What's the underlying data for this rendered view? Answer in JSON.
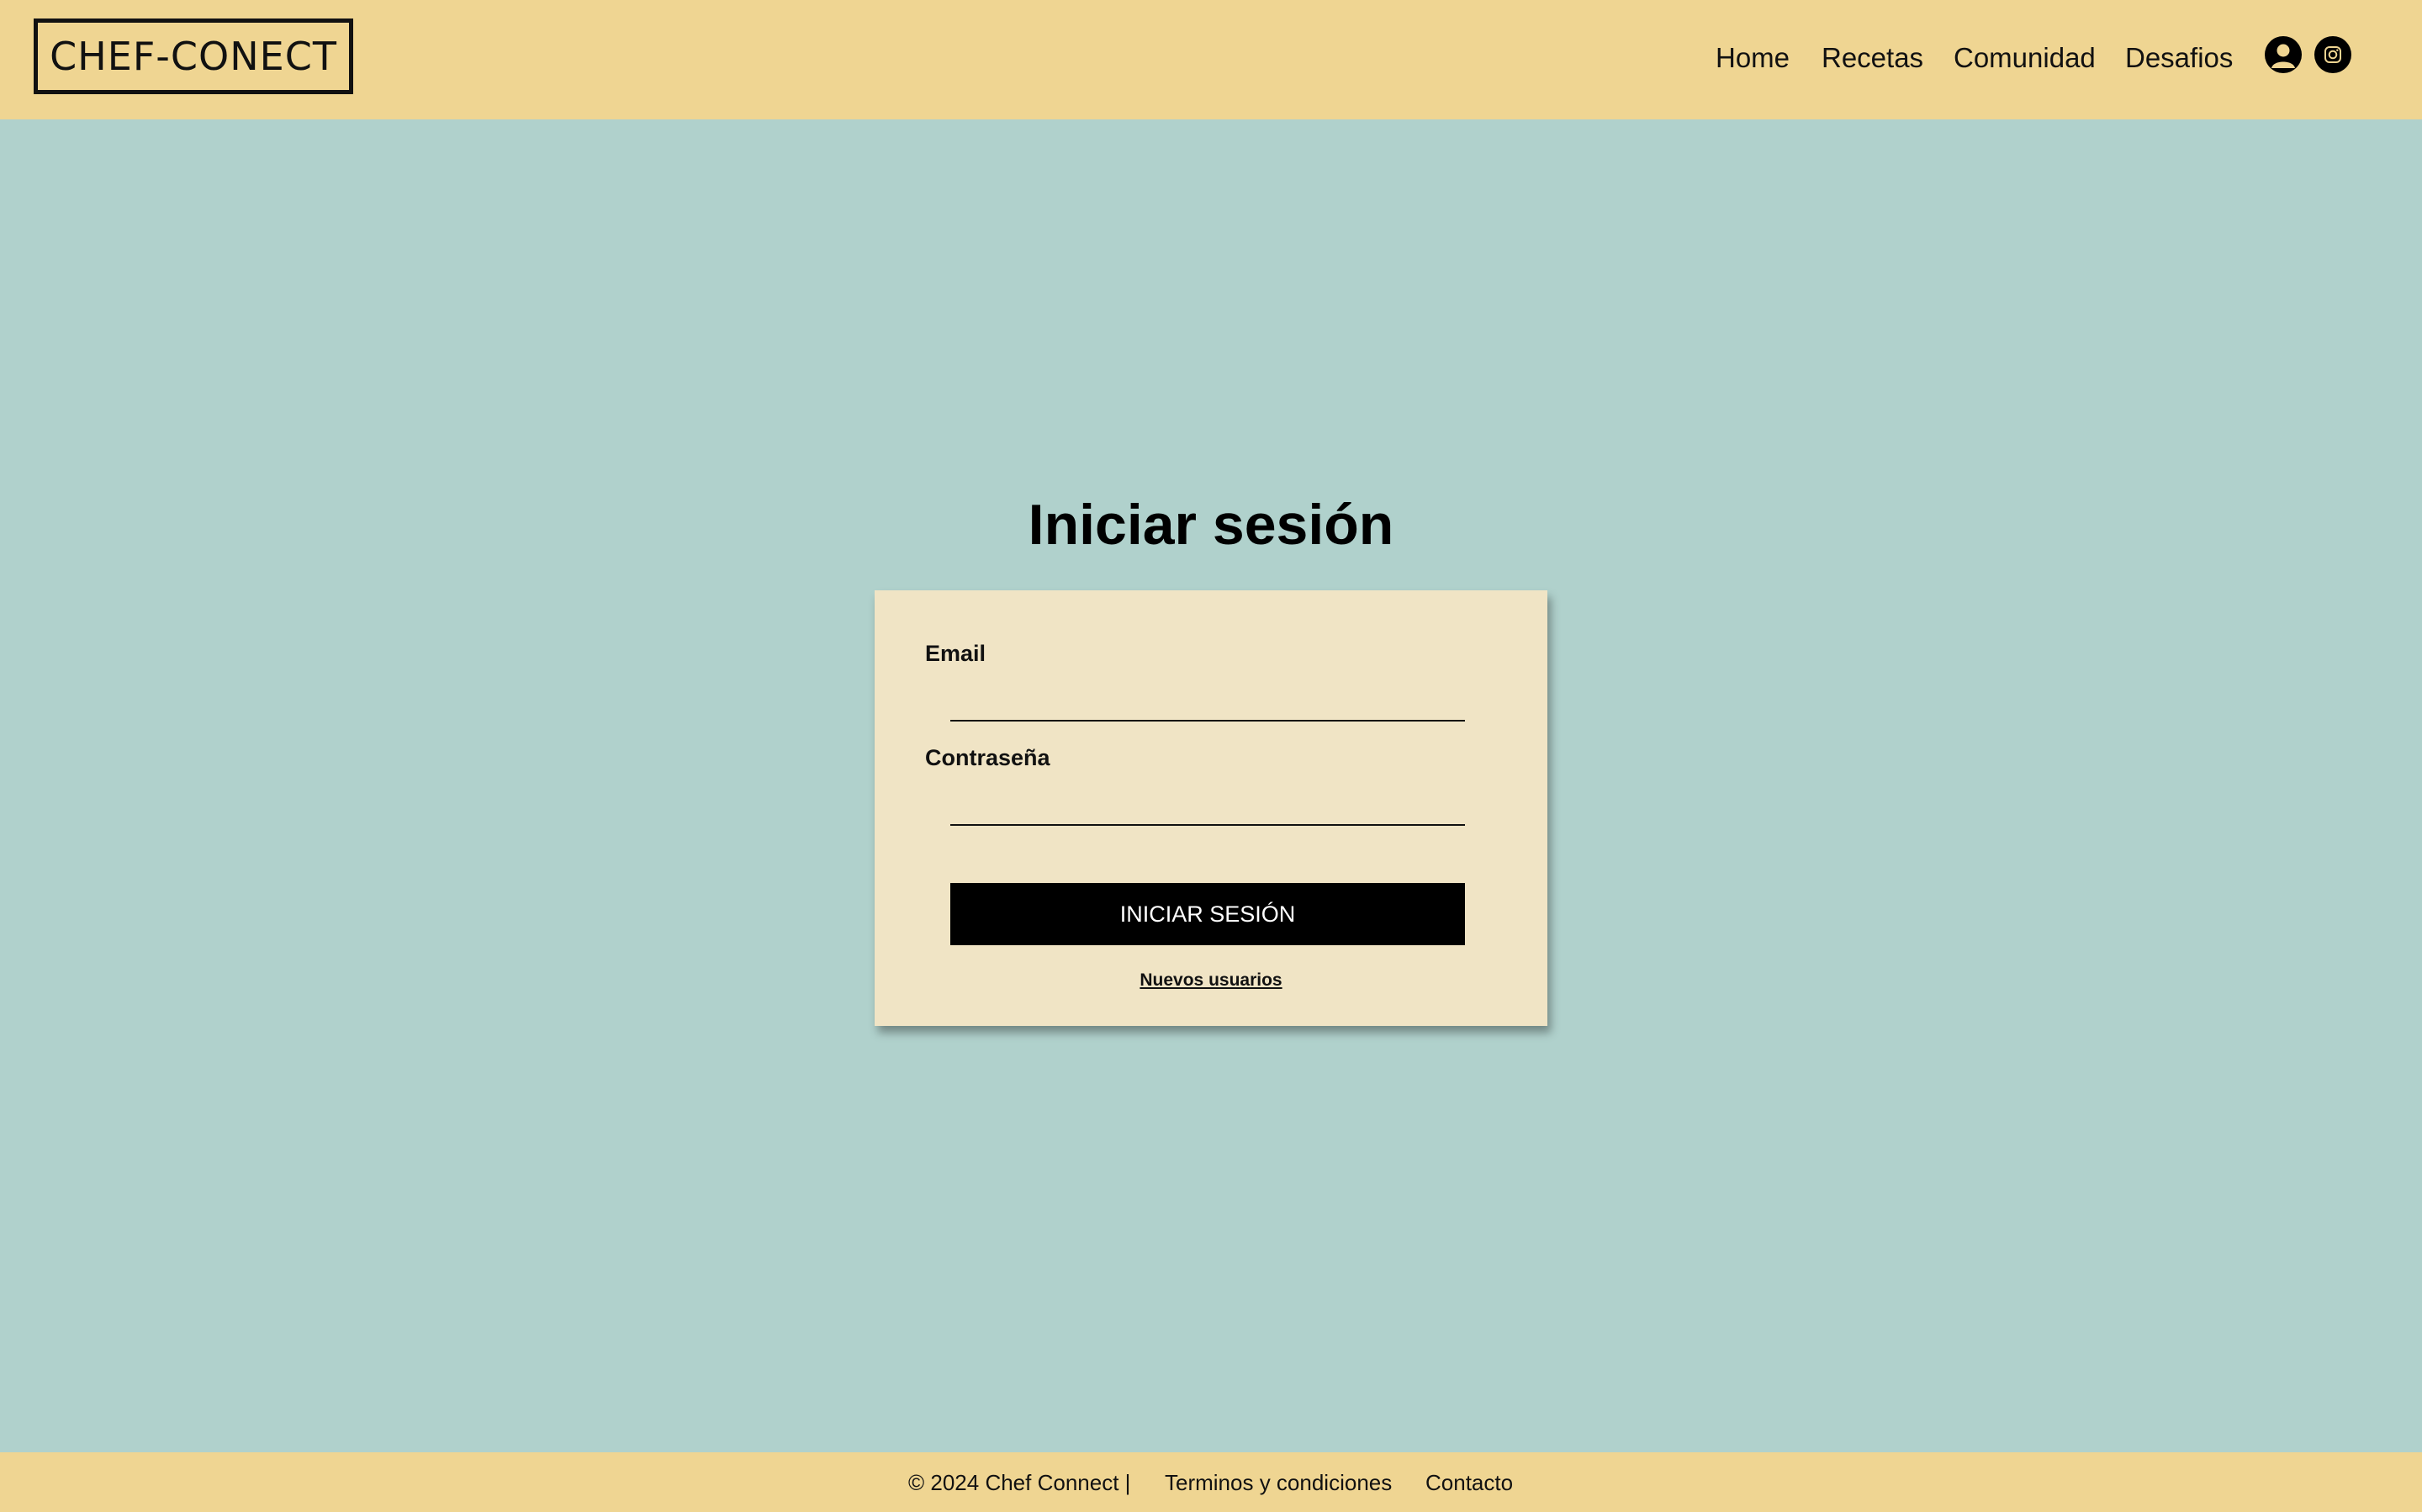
{
  "header": {
    "logo": "CHEF-CONECT",
    "nav": [
      "Home",
      "Recetas",
      "Comunidad",
      "Desafios"
    ],
    "icons": [
      "user-icon",
      "instagram-icon"
    ]
  },
  "main": {
    "title": "Iniciar sesión",
    "form": {
      "email_label": "Email",
      "email_value": "",
      "password_label": "Contraseña",
      "password_value": "",
      "submit_label": "INICIAR SESIÓN",
      "new_users_link": "Nuevos usuarios"
    }
  },
  "footer": {
    "copyright": "© 2024 Chef Connect |",
    "links": [
      "Terminos y condiciones",
      "Contacto"
    ]
  },
  "colors": {
    "header_bg": "#efd592",
    "page_bg": "#b0d1cc",
    "card_bg": "#f0e4c5",
    "button_bg": "#000000"
  }
}
